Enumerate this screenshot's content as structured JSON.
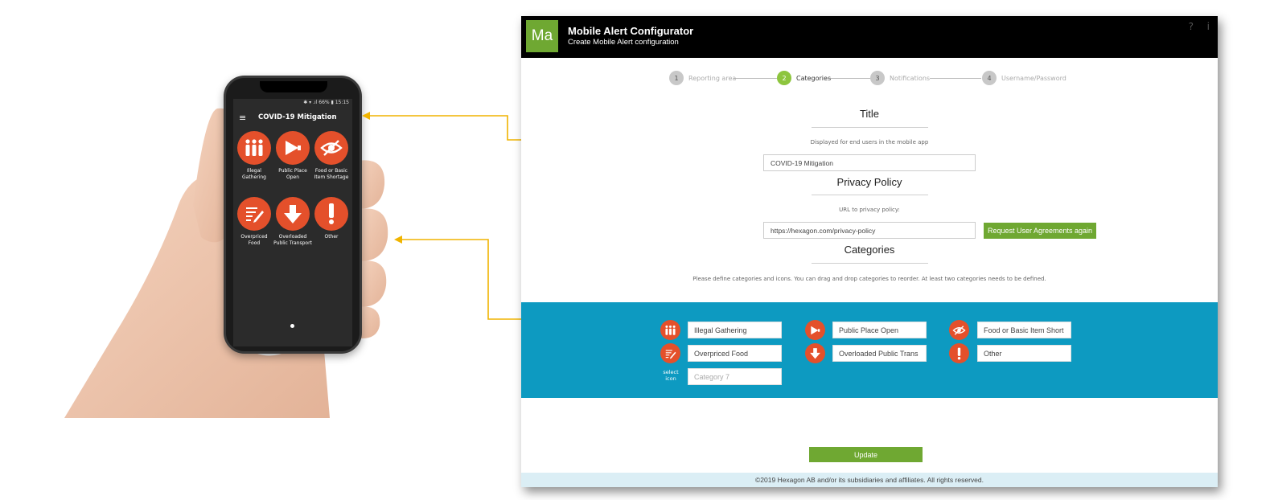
{
  "phone": {
    "status_bar": "✱ ▾ .ıl 66% ▮ 15:15",
    "menu_icon": "hamburger-icon",
    "title": "COVID-19 Mitigation",
    "categories": [
      {
        "label": "Illegal Gathering",
        "icon": "people-icon"
      },
      {
        "label": "Public Place Open",
        "icon": "megaphone-icon"
      },
      {
        "label": "Food or Basic Item Shortage",
        "icon": "eye-slash-icon"
      },
      {
        "label": "Overpriced Food",
        "icon": "pencil-list-icon"
      },
      {
        "label": "Overloaded Public Transport",
        "icon": "arrow-down-icon"
      },
      {
        "label": "Other",
        "icon": "exclamation-icon"
      }
    ]
  },
  "app": {
    "logo": "Ma",
    "title": "Mobile Alert Configurator",
    "subtitle": "Create Mobile Alert configuration",
    "help": "?",
    "info": "i",
    "steps": [
      {
        "num": "1",
        "label": "Reporting area"
      },
      {
        "num": "2",
        "label": "Categories"
      },
      {
        "num": "3",
        "label": "Notifications"
      },
      {
        "num": "4",
        "label": "Username/Password"
      }
    ],
    "title_section": {
      "heading": "Title",
      "hint": "Displayed for end users in the mobile app",
      "value": "COVID-19 Mitigation"
    },
    "privacy_section": {
      "heading": "Privacy Policy",
      "hint": "URL to privacy policy:",
      "value": "https://hexagon.com/privacy-policy",
      "button": "Request User Agreements again"
    },
    "categories_section": {
      "heading": "Categories",
      "hint": "Please define categories and icons. You can drag and drop categories to reorder. At least two categories needs to be defined.",
      "items": [
        {
          "value": "Illegal Gathering",
          "icon": "people-icon"
        },
        {
          "value": "Public Place Open",
          "icon": "megaphone-icon"
        },
        {
          "value": "Food or Basic Item Short",
          "icon": "eye-slash-icon"
        },
        {
          "value": "Overpriced Food",
          "icon": "pencil-list-icon"
        },
        {
          "value": "Overloaded Public Trans",
          "icon": "arrow-down-icon"
        },
        {
          "value": "Other",
          "icon": "exclamation-icon"
        }
      ],
      "new_category_placeholder": "Category 7",
      "select_icon_label": "select icon"
    },
    "update_button": "Update",
    "footer": "©2019 Hexagon AB and/or its subsidiaries and affiliates. All rights reserved."
  },
  "colors": {
    "accent_green": "#6fa832",
    "step_active": "#8dc53e",
    "band_blue": "#0d9ac1",
    "icon_orange": "#e4502b",
    "connector_yellow": "#f0b400"
  }
}
